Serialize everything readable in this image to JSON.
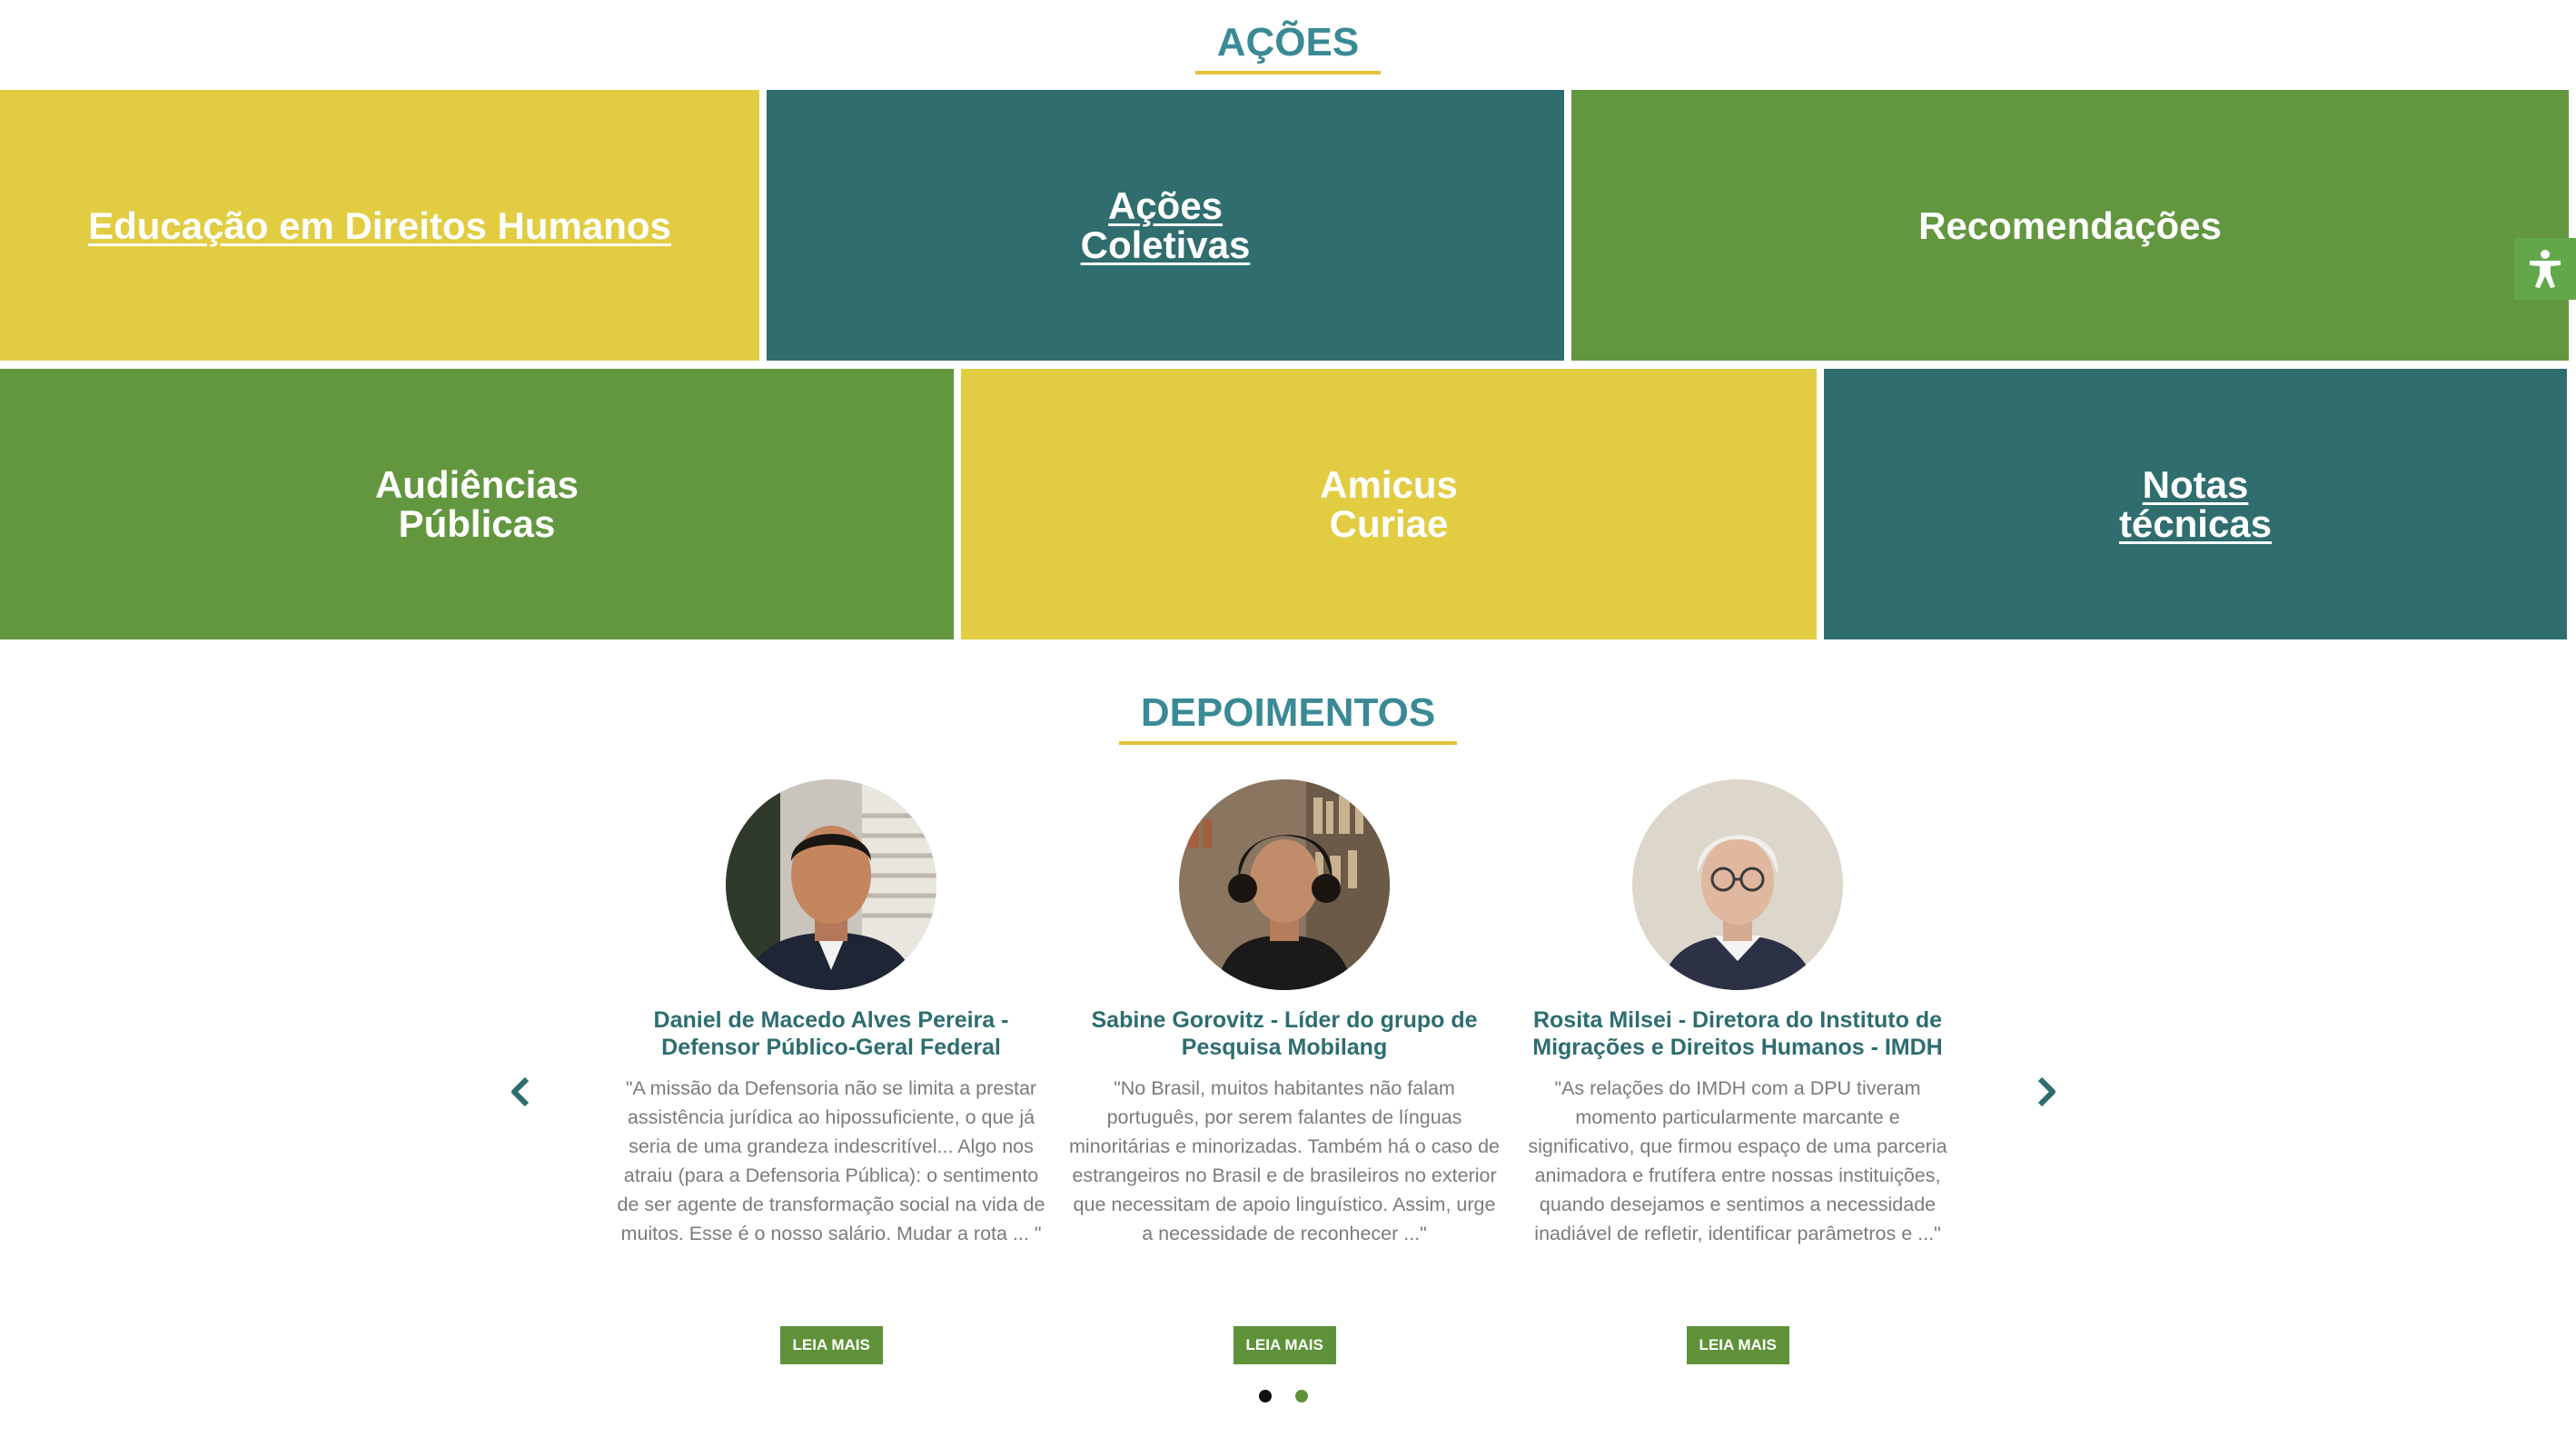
{
  "acoes": {
    "title": "AÇÕES",
    "tiles": [
      {
        "label": "Educação em Direitos Humanos"
      },
      {
        "label": "Ações\nColetivas"
      },
      {
        "label": "Recomendações"
      },
      {
        "label": "Audiências\nPúblicas"
      },
      {
        "label": "Amicus\nCuriae"
      },
      {
        "label": "Notas\ntécnicas"
      }
    ]
  },
  "accessibility": {
    "icon": "accessibility-icon"
  },
  "depoimentos": {
    "title": "DEPOIMENTOS",
    "cards": [
      {
        "name": "Daniel de Macedo Alves Pereira -\nDefensor Público-Geral Federal",
        "quote": "\"A missão da Defensoria não se limita a prestar assistência jurídica ao hipossuficiente, o que já seria de uma grandeza indescritível... Algo nos atraiu (para a Defensoria Pública): o sentimento de ser agente de transformação social na vida de muitos. Esse é o nosso salário. Mudar a rota ... \"",
        "button": "LEIA MAIS"
      },
      {
        "name": "Sabine Gorovitz - Líder do grupo de\nPesquisa Mobilang",
        "quote": "\"No Brasil, muitos habitantes não falam português, por serem falantes de línguas minoritárias e minorizadas. Também há o caso de estrangeiros no Brasil e de brasileiros no exterior que necessitam de apoio linguístico. Assim, urge a necessidade de reconhecer ...\"",
        "button": "LEIA MAIS"
      },
      {
        "name": "Rosita Milsei - Diretora do Instituto de\nMigrações e Direitos Humanos - IMDH",
        "quote": "\"As relações do IMDH com a DPU tiveram momento particularmente marcante e significativo, que firmou espaço de uma parceria animadora e frutífera entre nossas instituições, quando desejamos e sentimos a necessidade inadiável de refletir, identificar parâmetros e ...\"",
        "button": "LEIA MAIS"
      }
    ],
    "carousel": {
      "prev_icon": "chevron-left-icon",
      "next_icon": "chevron-right-icon",
      "page_count": 2,
      "active_page": 1
    }
  },
  "colors": {
    "yellow": "#e1cc42",
    "teal": "#306d6e",
    "green": "#629740",
    "title": "#3a8a95",
    "accent_line": "#e2c23a"
  }
}
